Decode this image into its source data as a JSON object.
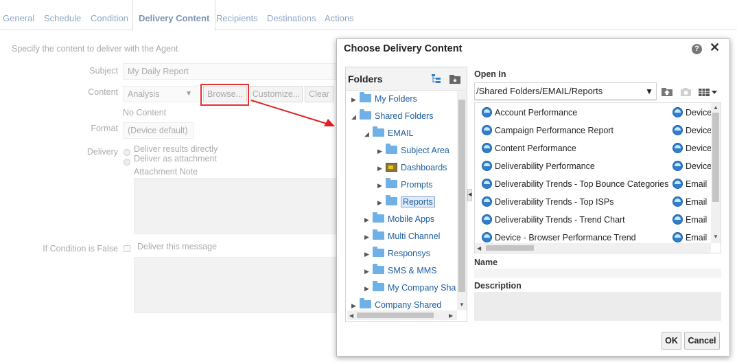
{
  "tabs": [
    {
      "label": "General"
    },
    {
      "label": "Schedule"
    },
    {
      "label": "Condition"
    },
    {
      "label": "Delivery Content"
    },
    {
      "label": "Recipients"
    },
    {
      "label": "Destinations"
    },
    {
      "label": "Actions"
    }
  ],
  "background": {
    "intro": "Specify the content to deliver with the Agent",
    "subject_label": "Subject",
    "subject_value": "My Daily Report",
    "content_label": "Content",
    "content_value": "Analysis",
    "browse_label": "Browse...",
    "customize_label": "Customize...",
    "clear_label": "Clear",
    "no_content": "No Content",
    "format_label": "Format",
    "format_value": "(Device default)",
    "delivery_label": "Delivery",
    "deliver_directly": "Deliver results directly",
    "deliver_attachment": "Deliver as attachment",
    "attachment_note": "Attachment Note",
    "if_condition_label": "If Condition is False",
    "deliver_message": "Deliver this message"
  },
  "dialog": {
    "title": "Choose Delivery Content",
    "folders_title": "Folders",
    "tree": [
      {
        "label": "My Folders"
      },
      {
        "label": "Shared Folders"
      },
      {
        "label": "EMAIL"
      },
      {
        "label": "Subject Area"
      },
      {
        "label": "Dashboards"
      },
      {
        "label": "Prompts"
      },
      {
        "label": "Reports"
      },
      {
        "label": "Mobile Apps"
      },
      {
        "label": "Multi Channel"
      },
      {
        "label": "Responsys"
      },
      {
        "label": "SMS & MMS"
      },
      {
        "label": "My Company Sha"
      },
      {
        "label": "Company Shared"
      }
    ],
    "open_in_label": "Open In",
    "open_in_path": "/Shared Folders/EMAIL/Reports",
    "items": [
      {
        "name": "Account Performance",
        "type": "Device"
      },
      {
        "name": "Campaign Performance Report",
        "type": "Device"
      },
      {
        "name": "Content Performance",
        "type": "Device"
      },
      {
        "name": "Deliverability Performance",
        "type": "Device"
      },
      {
        "name": "Deliverability Trends - Top Bounce Categories",
        "type": "Email"
      },
      {
        "name": "Deliverability Trends - Top ISPs",
        "type": "Email"
      },
      {
        "name": "Deliverability Trends - Trend Chart",
        "type": "Email"
      },
      {
        "name": "Device - Browser Performance Trend",
        "type": "Email"
      }
    ],
    "name_label": "Name",
    "description_label": "Description",
    "ok_label": "OK",
    "cancel_label": "Cancel"
  },
  "colors": {
    "tab_text": "#8fa7c2",
    "tree_link": "#1a5c9e",
    "annotation_red": "#dd2222"
  }
}
